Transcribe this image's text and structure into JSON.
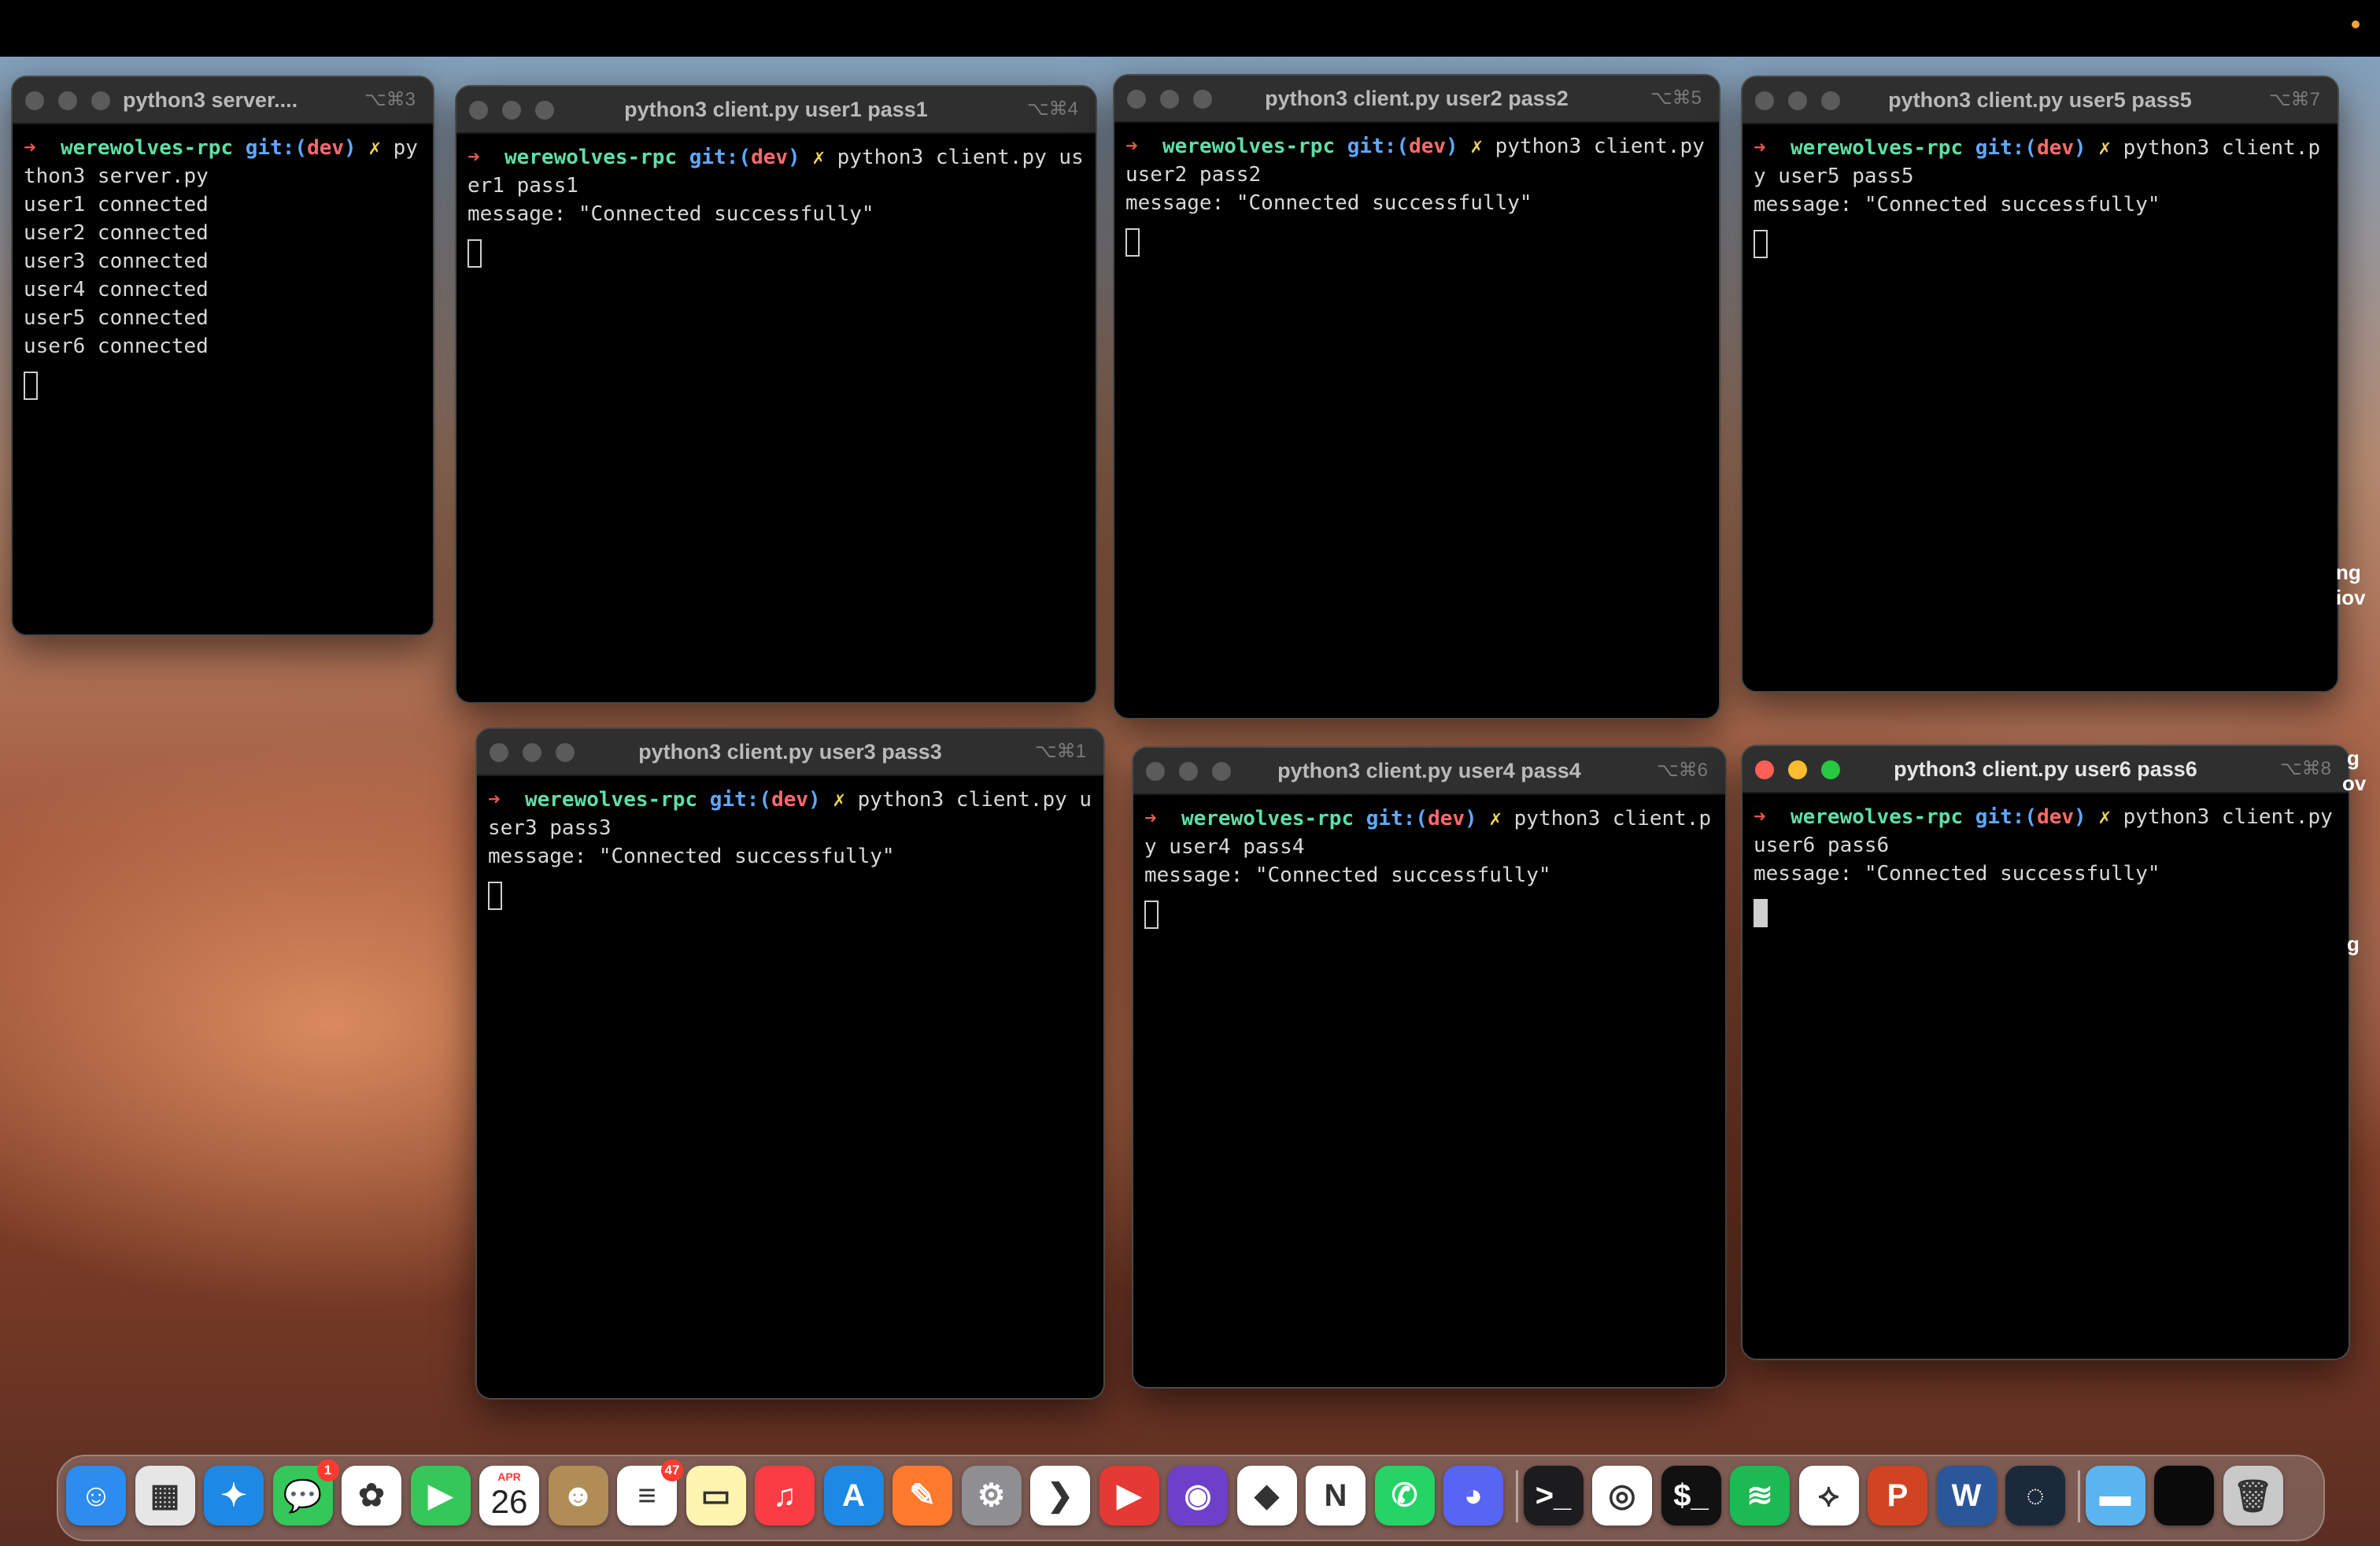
{
  "windows": [
    {
      "title": "python3 server....",
      "shortcut": "⌥⌘3",
      "lines": [
        {
          "cmd": "python3 server.py"
        },
        {
          "text": "user1 connected"
        },
        {
          "text": "user2 connected"
        },
        {
          "text": "user3 connected"
        },
        {
          "text": "user4 connected"
        },
        {
          "text": "user5 connected"
        },
        {
          "text": "user6 connected"
        }
      ]
    },
    {
      "title": "python3 client.py user1 pass1",
      "shortcut": "⌥⌘4",
      "lines": [
        {
          "cmd": "python3 client.py user1 pass1"
        },
        {
          "text": "message: \"Connected successfully\""
        }
      ]
    },
    {
      "title": "python3 client.py user2 pass2",
      "shortcut": "⌥⌘5",
      "lines": [
        {
          "cmd": "python3 client.py user2 pass2"
        },
        {
          "text": "message: \"Connected successfully\""
        }
      ]
    },
    {
      "title": "python3 client.py user5 pass5",
      "shortcut": "⌥⌘7",
      "lines": [
        {
          "cmd": "python3 client.py user5 pass5"
        },
        {
          "text": "message: \"Connected successfully\""
        }
      ]
    },
    {
      "title": "python3 client.py user3 pass3",
      "shortcut": "⌥⌘1",
      "lines": [
        {
          "cmd": "python3 client.py user3 pass3"
        },
        {
          "text": "message: \"Connected successfully\""
        }
      ]
    },
    {
      "title": "python3 client.py user4 pass4",
      "shortcut": "⌥⌘6",
      "lines": [
        {
          "cmd": "python3 client.py user4 pass4"
        },
        {
          "text": "message: \"Connected successfully\""
        }
      ]
    },
    {
      "title": "python3 client.py user6 pass6",
      "shortcut": "⌥⌘8",
      "lines": [
        {
          "cmd": "python3 client.py user6 pass6"
        },
        {
          "text": "message: \"Connected successfully\""
        }
      ]
    }
  ],
  "prompt": {
    "arrow": "➜",
    "repo": "werewolves-rpc",
    "git": "git:(",
    "branch": "dev",
    "git_close": ")",
    "dirty": "✗"
  },
  "dock": {
    "calendar_month": "APR",
    "calendar_day": "26",
    "messages_badge": "1",
    "reminders_badge": "47",
    "apps": [
      {
        "name": "finder",
        "icon": "finder-icon",
        "color": "#2d8cf0",
        "glyph": "☺"
      },
      {
        "name": "launchpad",
        "icon": "launchpad-icon",
        "color": "#e6e6e6",
        "glyph": "▦"
      },
      {
        "name": "safari",
        "icon": "safari-icon",
        "color": "#1e88e5",
        "glyph": "✦"
      },
      {
        "name": "messages",
        "icon": "messages-icon",
        "color": "#34c759",
        "glyph": "💬"
      },
      {
        "name": "photos",
        "icon": "photos-icon",
        "color": "#ffffff",
        "glyph": "✿"
      },
      {
        "name": "facetime",
        "icon": "facetime-icon",
        "color": "#34c759",
        "glyph": "▶"
      },
      {
        "name": "calendar",
        "icon": "calendar-icon",
        "color": "#ffffff",
        "glyph": ""
      },
      {
        "name": "contacts",
        "icon": "contacts-icon",
        "color": "#b08d57",
        "glyph": "☻"
      },
      {
        "name": "reminders",
        "icon": "reminders-icon",
        "color": "#ffffff",
        "glyph": "≡"
      },
      {
        "name": "notes",
        "icon": "notes-icon",
        "color": "#fff4b0",
        "glyph": "▭"
      },
      {
        "name": "music",
        "icon": "music-icon",
        "color": "#fc3c44",
        "glyph": "♫"
      },
      {
        "name": "app-store",
        "icon": "app-store-icon",
        "color": "#1e88e5",
        "glyph": "A"
      },
      {
        "name": "pencil-app",
        "icon": "pencil-icon",
        "color": "#ff7a2f",
        "glyph": "✎"
      },
      {
        "name": "system-settings",
        "icon": "gear-icon",
        "color": "#8e8e93",
        "glyph": "⚙"
      },
      {
        "name": "vscode",
        "icon": "vscode-icon",
        "color": "#ffffff",
        "glyph": "❯"
      },
      {
        "name": "media-player",
        "icon": "play-icon",
        "color": "#e53935",
        "glyph": "▶"
      },
      {
        "name": "github",
        "icon": "github-icon",
        "color": "#6e40c9",
        "glyph": "◉"
      },
      {
        "name": "clickup",
        "icon": "clickup-icon",
        "color": "#ffffff",
        "glyph": "◆"
      },
      {
        "name": "notion",
        "icon": "notion-icon",
        "color": "#ffffff",
        "glyph": "N"
      },
      {
        "name": "whatsapp",
        "icon": "whatsapp-icon",
        "color": "#25d366",
        "glyph": "✆"
      },
      {
        "name": "discord",
        "icon": "discord-icon",
        "color": "#5865f2",
        "glyph": "◕"
      },
      {
        "name": "terminal",
        "icon": "terminal-icon",
        "color": "#1c1c1e",
        "glyph": ">_"
      },
      {
        "name": "chrome",
        "icon": "chrome-icon",
        "color": "#ffffff",
        "glyph": "◎"
      },
      {
        "name": "terminal-2",
        "icon": "terminal-icon",
        "color": "#111111",
        "glyph": "$_"
      },
      {
        "name": "spotify",
        "icon": "spotify-icon",
        "color": "#1db954",
        "glyph": "≋"
      },
      {
        "name": "acrobat",
        "icon": "acrobat-icon",
        "color": "#ffffff",
        "glyph": "⟡"
      },
      {
        "name": "powerpoint",
        "icon": "powerpoint-icon",
        "color": "#d04423",
        "glyph": "P"
      },
      {
        "name": "word",
        "icon": "word-icon",
        "color": "#2b579a",
        "glyph": "W"
      },
      {
        "name": "screenshot-tool",
        "icon": "magnifier-icon",
        "color": "#1a2a3a",
        "glyph": "◌"
      },
      {
        "name": "downloads-folder",
        "icon": "folder-icon",
        "color": "#5ab4f0",
        "glyph": "▬"
      },
      {
        "name": "window-preview",
        "icon": "window-icon",
        "color": "#0a0a0a",
        "glyph": ""
      },
      {
        "name": "trash",
        "icon": "trash-icon",
        "color": "#c9c9c9",
        "glyph": "🗑"
      }
    ]
  },
  "edge_text": {
    "a": "ng",
    "b": "iov",
    "c": "g",
    "d": "ov",
    "e": "g"
  }
}
